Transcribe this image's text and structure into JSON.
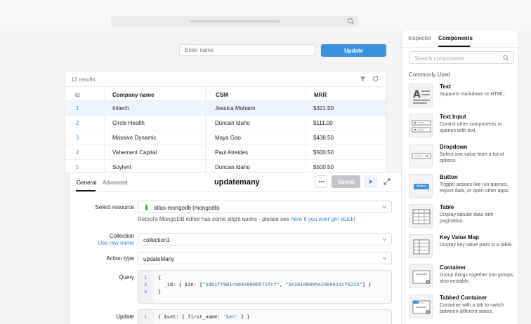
{
  "canvas": {
    "name_input_placeholder": "Enter name",
    "update_button": "Update",
    "table": {
      "results": "12 results",
      "columns": [
        "id",
        "Company name",
        "CSM",
        "MRR"
      ],
      "rows": [
        {
          "id": "1",
          "company": "Initech",
          "csm": "Jessica Mohaim",
          "mrr": "$321.50"
        },
        {
          "id": "2",
          "company": "Circle Health",
          "csm": "Duncan Idaho",
          "mrr": "$111.00"
        },
        {
          "id": "3",
          "company": "Massive Dynamic",
          "csm": "Maya Gao",
          "mrr": "$438.50"
        },
        {
          "id": "4",
          "company": "Vehement Capital",
          "csm": "Paul Atreides",
          "mrr": "$500.50"
        },
        {
          "id": "5",
          "company": "Soylent",
          "csm": "Duncan Idaho",
          "mrr": "$500.50"
        }
      ]
    }
  },
  "inspector": {
    "tabs": [
      "Inspector",
      "Components"
    ],
    "search_placeholder": "Search components",
    "section": "Commonly Used",
    "components": [
      {
        "title": "Text",
        "desc": "Supports markdown or HTML."
      },
      {
        "title": "Text Input",
        "desc": "Control other components or queries with text."
      },
      {
        "title": "Dropdown",
        "desc": "Select one value from a list of options."
      },
      {
        "title": "Button",
        "desc": "Trigger actions like run queries, export data, or open other apps."
      },
      {
        "title": "Table",
        "desc": "Display tabular data with pagination."
      },
      {
        "title": "Key Value Map",
        "desc": "Display key value pairs in a table."
      },
      {
        "title": "Container",
        "desc": "Group things together into groups, also nestable."
      },
      {
        "title": "Tabbed Container",
        "desc": "Container with a tab to switch between different states."
      }
    ],
    "button_thumb_label": "Action"
  },
  "query_panel": {
    "tabs": [
      "General",
      "Advanced"
    ],
    "title": "updatemany",
    "saved_button": "Saved",
    "select_resource_label": "Select resource",
    "resource_value": "atlas-mongodb (mongodb)",
    "helper_text": "Retool's MongoDB editor has some slight quirks - please see ",
    "helper_link": "here if you ever get stuck!",
    "collection_label": "Collection",
    "raw_name_link": "Use raw name",
    "collection_value": "collection1",
    "action_type_label": "Action type",
    "action_type_value": "updateMany",
    "query_label": "Query",
    "query_lines": [
      {
        "n": "1",
        "text": "{"
      },
      {
        "n": "2",
        "pre": "  _id: { $in: [",
        "s1": "\"5db1ff9d1c9d440000571fcf\"",
        "mid": ", ",
        "s2": "\"5e161d609542960014cf0225\"",
        "post": "] }"
      },
      {
        "n": "3",
        "text": "}"
      }
    ],
    "update_label": "Update",
    "update_line": {
      "n": "1",
      "pre": "{ $set: { first_name: ",
      "s": "'ken'",
      "post": " } }"
    }
  },
  "colors": {
    "accent": "#3c92dc",
    "link": "#3c86d6",
    "resource_dot": "#4caf50"
  }
}
